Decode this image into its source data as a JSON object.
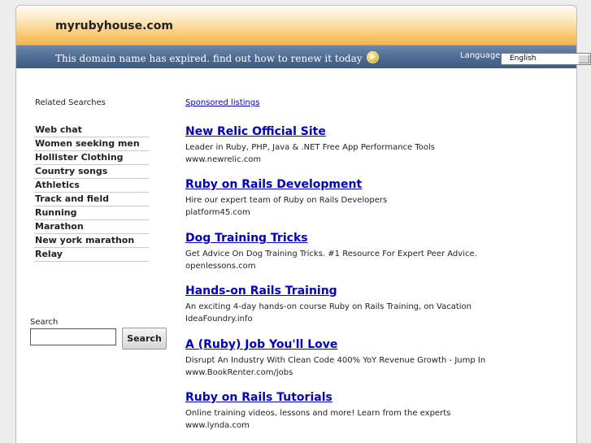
{
  "header": {
    "site_title": "myrubyhouse.com",
    "expired_message": "This domain name has expired. find out how to renew it today",
    "language_label": "Language:",
    "language_selected": "English"
  },
  "sidebar": {
    "related_title": "Related Searches",
    "items": [
      {
        "label": "Web chat"
      },
      {
        "label": "Women seeking men"
      },
      {
        "label": "Hollister Clothing"
      },
      {
        "label": "Country songs"
      },
      {
        "label": "Athletics"
      },
      {
        "label": "Track and field"
      },
      {
        "label": "Running"
      },
      {
        "label": "Marathon"
      },
      {
        "label": "New york marathon"
      },
      {
        "label": "Relay"
      }
    ],
    "search_label": "Search",
    "search_value": "",
    "search_button": "Search"
  },
  "main": {
    "sponsored_label": "Sponsored listings",
    "listings": [
      {
        "title": "New Relic Official Site",
        "desc": "Leader in Ruby, PHP, Java & .NET Free App Performance Tools",
        "url": "www.newrelic.com"
      },
      {
        "title": "Ruby on Rails Development",
        "desc": "Hire our expert team of Ruby on Rails Developers",
        "url": "platform45.com"
      },
      {
        "title": "Dog Training Tricks",
        "desc": "Get Advice On Dog Training Tricks. #1 Resource For Expert Peer Advice.",
        "url": "openlessons.com"
      },
      {
        "title": "Hands-on Rails Training",
        "desc": "An exciting 4-day hands-on course Ruby on Rails Training, on Vacation",
        "url": "IdeaFoundry.info"
      },
      {
        "title": "A (Ruby) Job You'll Love",
        "desc": "Disrupt An Industry With Clean Code 400% YoY Revenue Growth - Jump In",
        "url": "www.BookRenter.com/jobs"
      },
      {
        "title": "Ruby on Rails Tutorials",
        "desc": "Online training videos, lessons and more! Learn from the experts",
        "url": "www.lynda.com"
      }
    ]
  }
}
